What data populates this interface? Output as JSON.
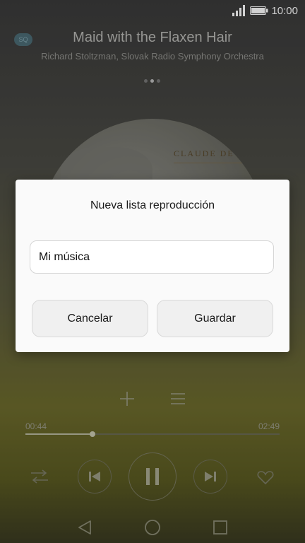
{
  "status_bar": {
    "time": "10:00"
  },
  "player": {
    "title": "Maid with the Flaxen Hair",
    "artist": "Richard Stoltzman, Slovak Radio Symphony Orchestra",
    "hq_badge": "SQ",
    "album_text": "CLAUDE DE",
    "time_elapsed": "00:44",
    "time_total": "02:49",
    "progress_fraction": 0.264
  },
  "dialog": {
    "title": "Nueva lista reproducción",
    "input_value": "Mi música",
    "cancel_label": "Cancelar",
    "save_label": "Guardar"
  },
  "icons": [
    "signal-icon",
    "battery-icon",
    "add-icon",
    "list-icon",
    "shuffle-icon",
    "previous-icon",
    "pause-icon",
    "next-icon",
    "heart-icon",
    "back-icon",
    "home-icon",
    "recent-apps-icon"
  ],
  "colors": {
    "dialog_bg": "#fafafa",
    "button_bg": "#f0f0f0",
    "accent_knob": "#c8c8b0"
  }
}
